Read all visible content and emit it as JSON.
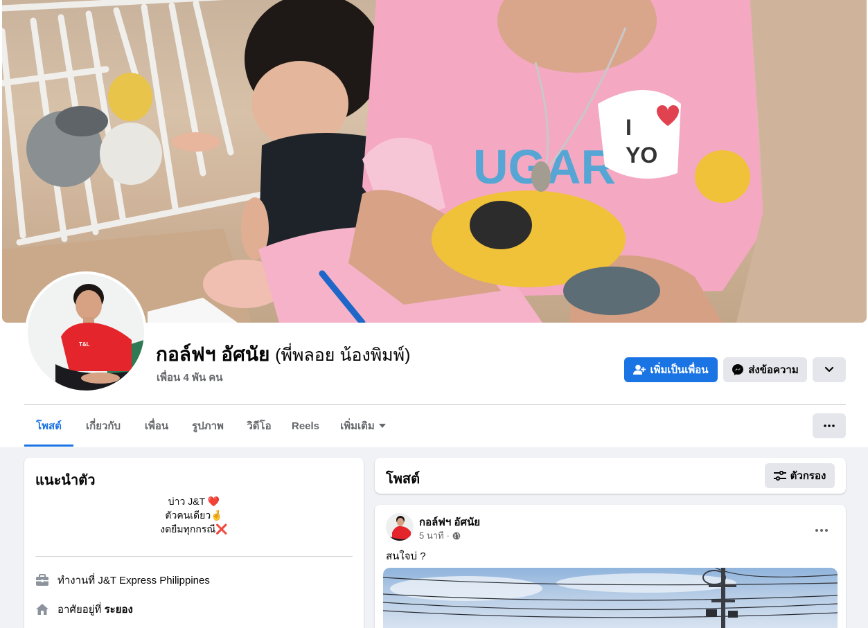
{
  "profile": {
    "name": "กอล์ฟฯ อัศนัย",
    "alternate_name": "(พี่พลอย น้องพิมพ์)",
    "friends": "เพื่อน 4 พัน คน"
  },
  "actions": {
    "add_friend": "เพิ่มเป็นเพื่อน",
    "message": "ส่งข้อความ"
  },
  "tabs": [
    {
      "label": "โพสต์",
      "active": true
    },
    {
      "label": "เกี่ยวกับ"
    },
    {
      "label": "เพื่อน"
    },
    {
      "label": "รูปภาพ"
    },
    {
      "label": "วิดีโอ"
    },
    {
      "label": "Reels"
    },
    {
      "label": "เพิ่มเติม"
    }
  ],
  "intro": {
    "title": "แนะนำตัว",
    "bio": [
      "บ่าว J&T ❤️",
      "ตัวคนเดียว🤞",
      "งดยืมทุกกรณี❌"
    ],
    "work_prefix": "ทำงานที่ ",
    "work_place": "J&T Express Philippines",
    "lives_prefix": "อาศัยอยู่ที่ ",
    "lives_place": "ระยอง"
  },
  "posts_header": {
    "title": "โพสต์",
    "filter": "ตัวกรอง"
  },
  "post": {
    "author": "กอล์ฟฯ อัศนัย",
    "time": "5 นาที",
    "separator": "·",
    "text": "สนใจบ่ ?"
  },
  "icons": {
    "add_friend": "person-add-icon",
    "message": "messenger-icon",
    "dropdown": "chevron-down-icon",
    "more": "more-icon",
    "filter": "filter-icon",
    "work": "briefcase-icon",
    "home": "home-icon",
    "privacy": "globe-icon"
  },
  "colors": {
    "primary": "#1b74e4",
    "secondary_bg": "#e4e6eb",
    "page_bg": "#f0f2f5",
    "muted_text": "#65676b"
  }
}
